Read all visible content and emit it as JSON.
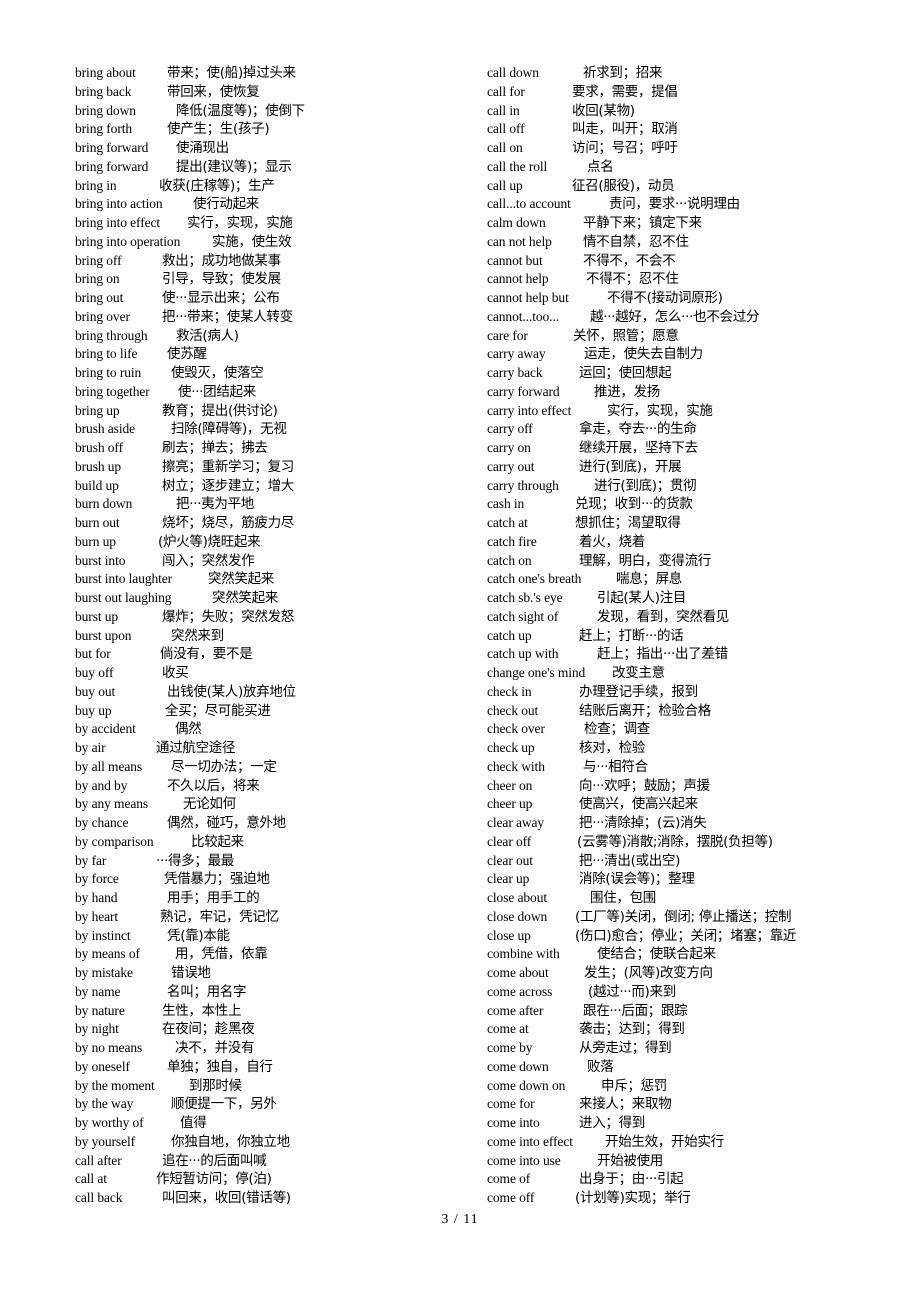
{
  "document": {
    "footer_page": "3  / 11",
    "page_number": 3,
    "page_total": 11,
    "background_color": "#ffffff",
    "text_color": "#000000"
  },
  "columns": {
    "left": [
      {
        "term": "bring about",
        "def": "带来；使(船)掉过头来",
        "indent": 92
      },
      {
        "term": "bring back",
        "def": "带回来，使恢复",
        "indent": 92
      },
      {
        "term": "bring down",
        "def": "降低(温度等)；使倒下",
        "indent": 101
      },
      {
        "term": "bring forth",
        "def": "使产生；生(孩子)",
        "indent": 92
      },
      {
        "term": "bring forward",
        "def": "使涌现出",
        "indent": 101
      },
      {
        "term": "bring forward",
        "def": "提出(建议等)；显示",
        "indent": 101
      },
      {
        "term": "bring in",
        "def": "收获(庄稼等)；生产",
        "indent": 84
      },
      {
        "term": "bring into action",
        "def": "使行动起来",
        "indent": 118
      },
      {
        "term": "bring into effect",
        "def": "实行，实现，实施",
        "indent": 112
      },
      {
        "term": "bring into operation",
        "def": "实施，使生效",
        "indent": 137
      },
      {
        "term": "bring off",
        "def": "救出；成功地做某事",
        "indent": 87
      },
      {
        "term": "bring on",
        "def": "引导，导致；使发展",
        "indent": 87
      },
      {
        "term": "bring out",
        "def": "使···显示出来；公布",
        "indent": 87
      },
      {
        "term": "bring over",
        "def": "把···带来；使某人转变",
        "indent": 87
      },
      {
        "term": "bring through",
        "def": "救活(病人)",
        "indent": 101
      },
      {
        "term": "bring to life",
        "def": "使苏醒",
        "indent": 92
      },
      {
        "term": "bring to ruin",
        "def": "使毁灭，使落空",
        "indent": 96
      },
      {
        "term": "bring together",
        "def": "使···团结起来",
        "indent": 103
      },
      {
        "term": "bring up",
        "def": "教育；提出(供讨论)",
        "indent": 87
      },
      {
        "term": "brush aside",
        "def": "扫除(障碍等)，无视",
        "indent": 96
      },
      {
        "term": "brush off",
        "def": "刷去；掸去；拂去",
        "indent": 87
      },
      {
        "term": "brush up",
        "def": "擦亮；重新学习；复习",
        "indent": 87
      },
      {
        "term": "build up",
        "def": "树立；逐步建立；增大",
        "indent": 87
      },
      {
        "term": "burn down",
        "def": "把···夷为平地",
        "indent": 101
      },
      {
        "term": "burn out",
        "def": "烧坏；烧尽，筋疲力尽",
        "indent": 87
      },
      {
        "term": "burn up",
        "def": "(炉火等)烧旺起来",
        "indent": 83
      },
      {
        "term": "burst into",
        "def": "闯入；突然发作",
        "indent": 87
      },
      {
        "term": "burst into laughter",
        "def": "突然笑起来",
        "indent": 133
      },
      {
        "term": "burst out laughing",
        "def": "突然笑起来",
        "indent": 137
      },
      {
        "term": "burst up",
        "def": "爆炸；失败；突然发怒",
        "indent": 87
      },
      {
        "term": "burst upon",
        "def": "突然来到",
        "indent": 96
      },
      {
        "term": "but for",
        "def": "倘没有，要不是",
        "indent": 85
      },
      {
        "term": "buy off",
        "def": "收买",
        "indent": 87
      },
      {
        "term": "buy out",
        "def": "出钱使(某人)放弃地位",
        "indent": 92
      },
      {
        "term": "buy up",
        "def": "全买；尽可能买进",
        "indent": 90
      },
      {
        "term": "by accident",
        "def": "偶然",
        "indent": 100
      },
      {
        "term": "by air",
        "def": "通过航空途径",
        "indent": 81
      },
      {
        "term": "by all means",
        "def": "尽一切办法；一定",
        "indent": 96
      },
      {
        "term": "by and by",
        "def": "不久以后，将来",
        "indent": 92
      },
      {
        "term": "by any means",
        "def": "无论如何",
        "indent": 108
      },
      {
        "term": "by chance",
        "def": "偶然，碰巧，意外地",
        "indent": 92
      },
      {
        "term": "by comparison",
        "def": "比较起来",
        "indent": 116
      },
      {
        "term": "by far",
        "def": "···得多；最最",
        "indent": 81
      },
      {
        "term": "by force",
        "def": "凭借暴力；强迫地",
        "indent": 89
      },
      {
        "term": "by hand",
        "def": "用手；用手工的",
        "indent": 92
      },
      {
        "term": "by heart",
        "def": "熟记，牢记，凭记忆",
        "indent": 85
      },
      {
        "term": "by instinct",
        "def": "凭(靠)本能",
        "indent": 92
      },
      {
        "term": "by means of",
        "def": "用，凭借，依靠",
        "indent": 100
      },
      {
        "term": "by mistake",
        "def": "错误地",
        "indent": 96
      },
      {
        "term": "by name",
        "def": "名叫；用名字",
        "indent": 92
      },
      {
        "term": "by nature",
        "def": "生性，本性上",
        "indent": 87
      },
      {
        "term": "by night",
        "def": "在夜间；趁黑夜",
        "indent": 87
      },
      {
        "term": "by no means",
        "def": "决不，并没有",
        "indent": 100
      },
      {
        "term": "by oneself",
        "def": "单独；独自，自行",
        "indent": 92
      },
      {
        "term": "by the moment",
        "def": "到那时候",
        "indent": 114
      },
      {
        "term": "by the way",
        "def": "顺便提一下，另外",
        "indent": 96
      },
      {
        "term": "by worthy of",
        "def": "值得",
        "indent": 105
      },
      {
        "term": "by yourself",
        "def": "你独自地，你独立地",
        "indent": 96
      },
      {
        "term": "call after",
        "def": "追在···的后面叫喊",
        "indent": 87
      },
      {
        "term": "call at",
        "def": "作短暂访问；停(泊)",
        "indent": 81
      },
      {
        "term": "call back",
        "def": "叫回来，收回(错话等)",
        "indent": 87
      }
    ],
    "right": [
      {
        "term": "call down",
        "def": "祈求到；招来",
        "indent": 96
      },
      {
        "term": "call for",
        "def": "要求，需要，提倡",
        "indent": 85
      },
      {
        "term": "call in",
        "def": "收回(某物)",
        "indent": 85
      },
      {
        "term": "call off",
        "def": "叫走，叫开；取消",
        "indent": 85
      },
      {
        "term": "call on",
        "def": "访问；号召；呼吁",
        "indent": 85
      },
      {
        "term": "call the roll",
        "def": "点名",
        "indent": 100
      },
      {
        "term": "call up",
        "def": "征召(服役)，动员",
        "indent": 85
      },
      {
        "term": "call...to account",
        "def": "责问，要求···说明理由",
        "indent": 122
      },
      {
        "term": "calm down",
        "def": "平静下来；镇定下来",
        "indent": 96
      },
      {
        "term": "can not help",
        "def": "情不自禁，忍不住",
        "indent": 96
      },
      {
        "term": "cannot but",
        "def": "不得不，不会不",
        "indent": 96
      },
      {
        "term": "cannot help",
        "def": "不得不；忍不住",
        "indent": 99
      },
      {
        "term": "cannot help but",
        "def": "不得不(接动词原形)",
        "indent": 120
      },
      {
        "term": "cannot...too...",
        "def": "越···越好，怎么···也不会过分",
        "indent": 103
      },
      {
        "term": "care for",
        "def": "关怀，照管；愿意",
        "indent": 86
      },
      {
        "term": "carry away",
        "def": "运走，使失去自制力",
        "indent": 97
      },
      {
        "term": "carry back",
        "def": "运回；使回想起",
        "indent": 92
      },
      {
        "term": "carry forward",
        "def": "推进，发扬",
        "indent": 107
      },
      {
        "term": "carry into effect",
        "def": "实行，实现，实施",
        "indent": 120
      },
      {
        "term": "carry off",
        "def": "拿走，夺去···的生命",
        "indent": 92
      },
      {
        "term": "carry on",
        "def": "继续开展，坚持下去",
        "indent": 92
      },
      {
        "term": "carry out",
        "def": "进行(到底)，开展",
        "indent": 92
      },
      {
        "term": "carry through",
        "def": "进行(到底)；贯彻",
        "indent": 107
      },
      {
        "term": "cash in",
        "def": "兑现；收到···的货款",
        "indent": 88
      },
      {
        "term": "catch at",
        "def": "想抓住；渴望取得",
        "indent": 88
      },
      {
        "term": "catch fire",
        "def": "着火，烧着",
        "indent": 92
      },
      {
        "term": "catch on",
        "def": "理解，明白，变得流行",
        "indent": 92
      },
      {
        "term": "catch one's breath",
        "def": "喘息；屏息",
        "indent": 129
      },
      {
        "term": "catch sb.'s eye",
        "def": "引起(某人)注目",
        "indent": 110
      },
      {
        "term": "catch sight of",
        "def": "发现，看到，突然看见",
        "indent": 110
      },
      {
        "term": "catch up",
        "def": "赶上；打断···的话",
        "indent": 92
      },
      {
        "term": "catch up with",
        "def": "赶上；指出···出了差错",
        "indent": 110
      },
      {
        "term": "change one's mind",
        "def": "改变主意",
        "indent": 125
      },
      {
        "term": "check in",
        "def": "办理登记手续，报到",
        "indent": 92
      },
      {
        "term": "check out",
        "def": "结账后离开；检验合格",
        "indent": 92
      },
      {
        "term": "check over",
        "def": "检查；调查",
        "indent": 97
      },
      {
        "term": "check up",
        "def": "核对，检验",
        "indent": 92
      },
      {
        "term": "check with",
        "def": "与···相符合",
        "indent": 96
      },
      {
        "term": "cheer on",
        "def": "向···欢呼；鼓励；声援",
        "indent": 92
      },
      {
        "term": "cheer up",
        "def": "使高兴，使高兴起来",
        "indent": 92
      },
      {
        "term": "clear away",
        "def": "把···清除掉；(云)消失",
        "indent": 92
      },
      {
        "term": "clear off",
        "def": "(云雾等)消散;消除，摆脱(负担等)",
        "indent": 90
      },
      {
        "term": "clear out",
        "def": "把···清出(或出空)",
        "indent": 92
      },
      {
        "term": "clear up",
        "def": "消除(误会等)；整理",
        "indent": 92
      },
      {
        "term": "close about",
        "def": "围住，包围",
        "indent": 103
      },
      {
        "term": "close down",
        "def": "(工厂等)关闭，倒闭; 停止播送；控制",
        "indent": 88
      },
      {
        "term": "close up",
        "def": "(伤口)愈合；停业；关闭；堵塞；靠近",
        "indent": 88
      },
      {
        "term": "combine with",
        "def": "使结合；使联合起来",
        "indent": 110
      },
      {
        "term": "come about",
        "def": "发生；(风等)改变方向",
        "indent": 97
      },
      {
        "term": "come across",
        "def": "(越过···而)来到",
        "indent": 101
      },
      {
        "term": "come after",
        "def": "跟在···后面；跟踪",
        "indent": 96
      },
      {
        "term": "come at",
        "def": "袭击；达到；得到",
        "indent": 92
      },
      {
        "term": "come by",
        "def": "从旁走过；得到",
        "indent": 92
      },
      {
        "term": "come down",
        "def": "败落",
        "indent": 100
      },
      {
        "term": "come down on",
        "def": "申斥；惩罚",
        "indent": 114
      },
      {
        "term": "come for",
        "def": "来接人；来取物",
        "indent": 92
      },
      {
        "term": "come into",
        "def": "进入；得到",
        "indent": 92
      },
      {
        "term": "come into effect",
        "def": "开始生效，开始实行",
        "indent": 118
      },
      {
        "term": "come into use",
        "def": "开始被使用",
        "indent": 110
      },
      {
        "term": "come of",
        "def": "出身于；由···引起",
        "indent": 92
      },
      {
        "term": "come off",
        "def": "(计划等)实现；举行",
        "indent": 88
      }
    ]
  }
}
